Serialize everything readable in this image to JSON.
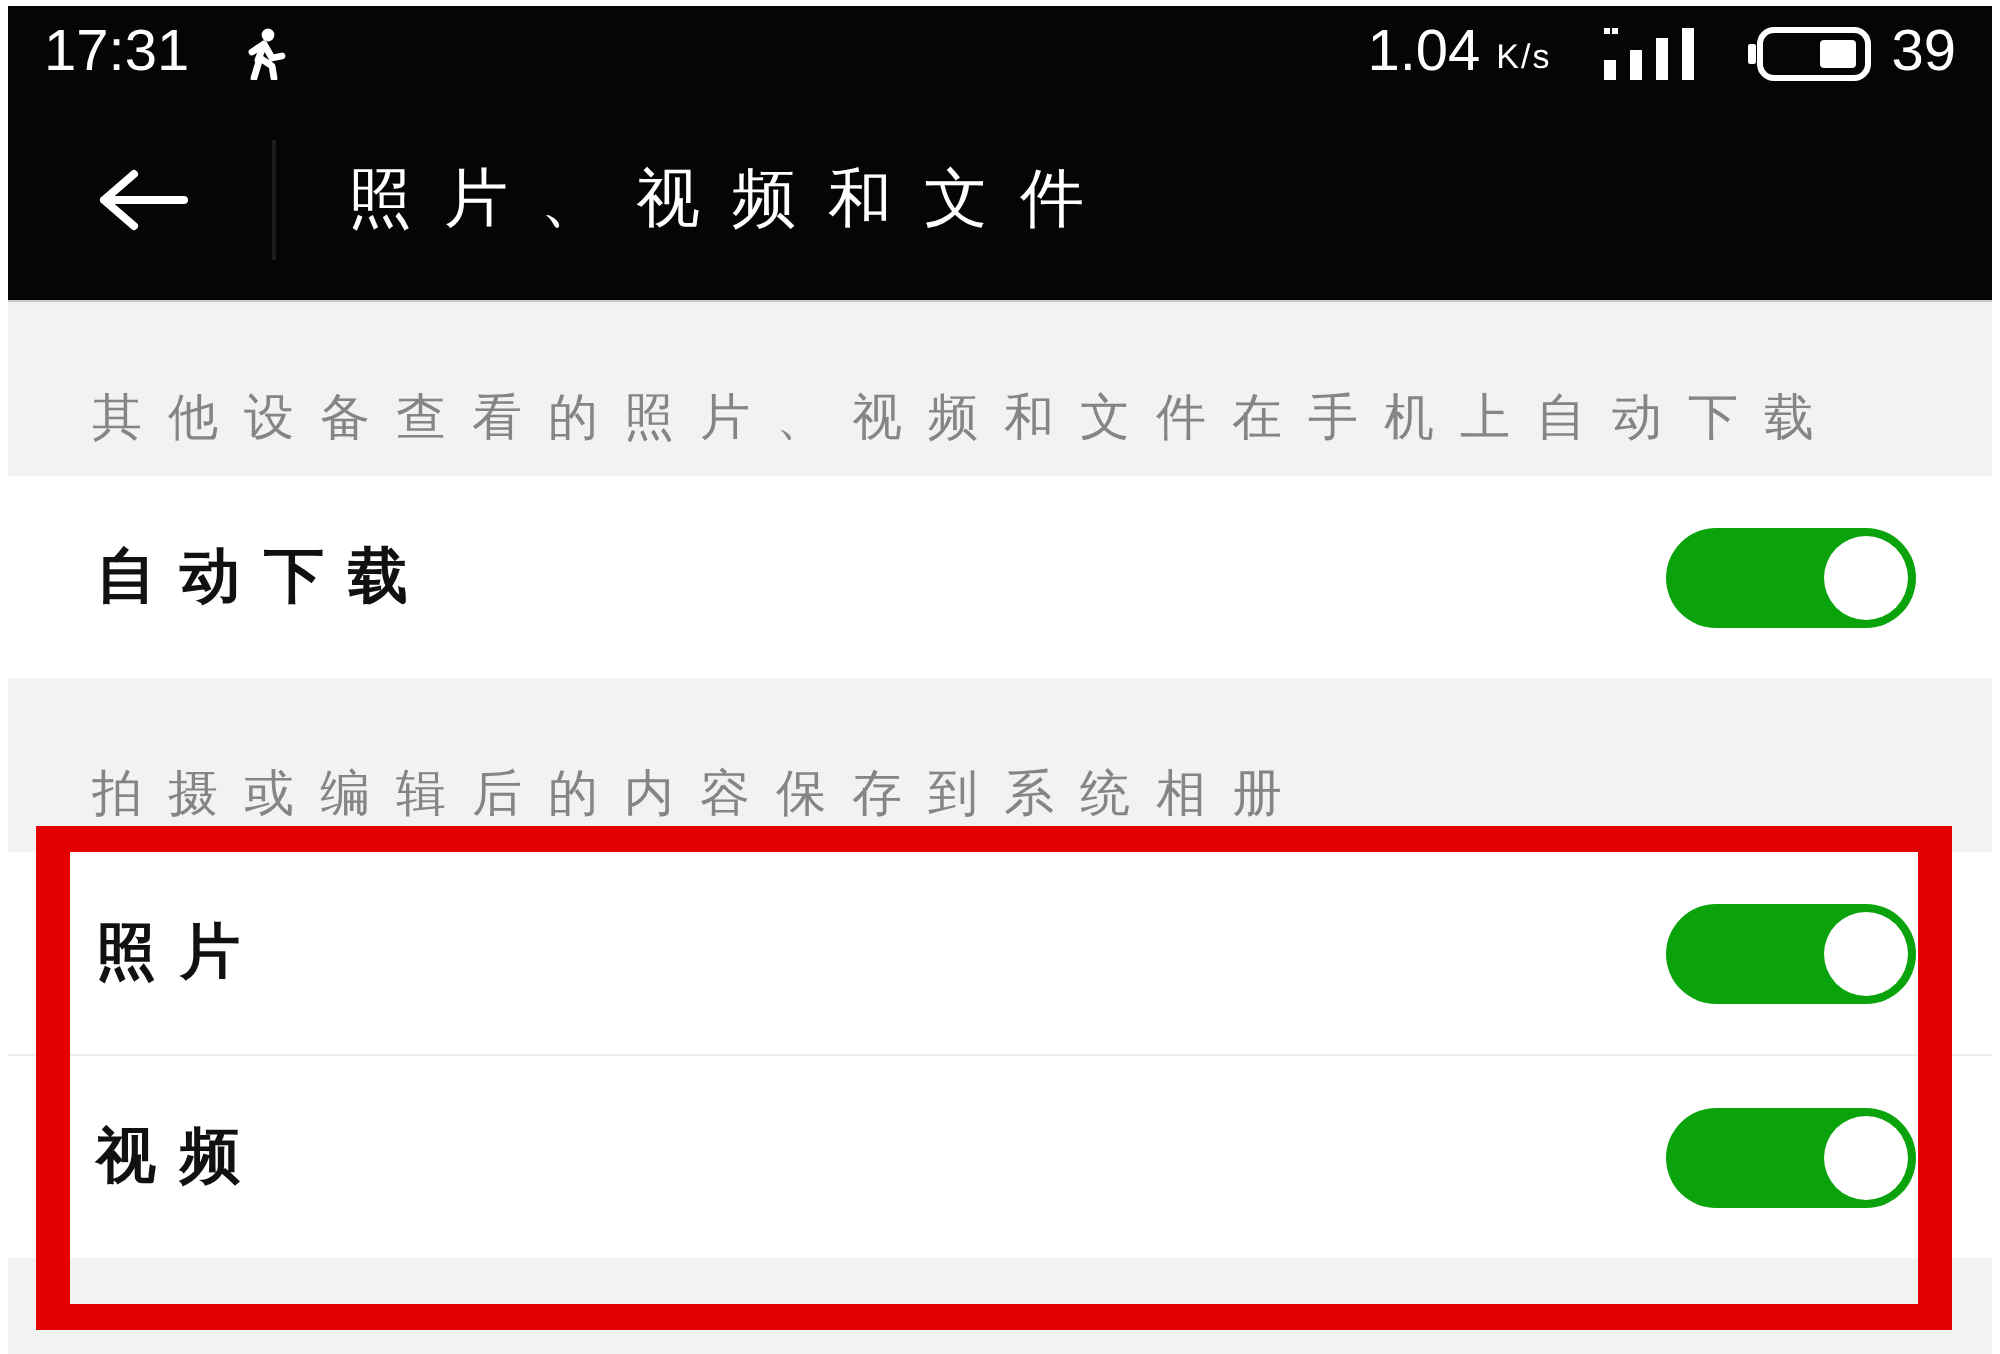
{
  "status_bar": {
    "time": "17:31",
    "net_speed": "1.04",
    "speed_unit": "K/s",
    "battery": "39"
  },
  "header": {
    "title": "照片、视频和文件"
  },
  "sections": [
    {
      "caption": "其他设备查看的照片、视频和文件在手机上自动下载",
      "highlighted": false,
      "items": [
        {
          "label": "自动下载",
          "on": true
        }
      ]
    },
    {
      "caption": "拍摄或编辑后的内容保存到系统相册",
      "highlighted": true,
      "items": [
        {
          "label": "照片",
          "on": true
        },
        {
          "label": "视频",
          "on": true
        }
      ]
    }
  ]
}
